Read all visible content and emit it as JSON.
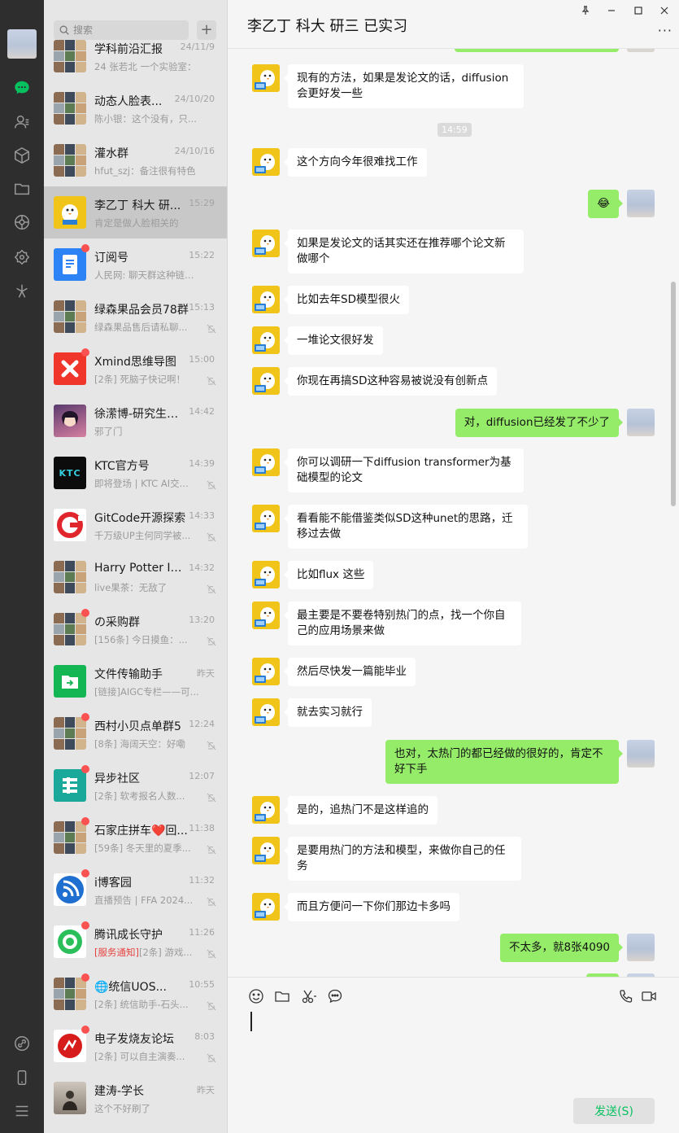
{
  "search": {
    "placeholder": "搜索"
  },
  "sidebar_icons": [
    "chat-icon",
    "contacts-icon",
    "cube-icon",
    "folder-icon",
    "moments-icon",
    "mini-program-icon",
    "channels-icon",
    "link-icon",
    "phone-icon",
    "menu-icon"
  ],
  "sessions": [
    {
      "name": "学科前沿汇报",
      "time": "24/11/9",
      "preview": "24 张若北 一个实验室："
    },
    {
      "name": "动态人脸表...",
      "time": "24/10/20",
      "preview": "陈小银：这个没有，只..."
    },
    {
      "name": "灌水群",
      "time": "24/10/16",
      "preview": "hfut_szj：备注很有特色"
    },
    {
      "name": "李乙丁 科大 研...",
      "time": "15:29",
      "preview": "肯定是做人脸相关的"
    },
    {
      "name": "订阅号",
      "time": "15:22",
      "preview": "人民网: 聊天群这种链接..."
    },
    {
      "name": "绿森果品会员78群",
      "time": "15:13",
      "preview": "绿森果品售后请私聊..."
    },
    {
      "name": "Xmind思维导图",
      "time": "15:00",
      "preview": "[2条] 死脑子快记啊！"
    },
    {
      "name": "徐潆博-研究生同...",
      "time": "14:42",
      "preview": "邪了门"
    },
    {
      "name": "KTC官方号",
      "time": "14:39",
      "preview": "即将登场 | KTC AI交..."
    },
    {
      "name": "GitCode开源探索",
      "time": "14:33",
      "preview": "千万级UP主何同学被..."
    },
    {
      "name": "Harry Potter IM...",
      "time": "14:32",
      "preview": "live果茶：无敌了"
    },
    {
      "name": "の采购群",
      "time": "13:20",
      "preview": "[156条] 今日摸鱼：..."
    },
    {
      "name": "文件传输助手",
      "time": "昨天",
      "preview": "[链接]AIGC专栏——可..."
    },
    {
      "name": "西村小贝点单群5",
      "time": "12:24",
      "preview": "[8条] 海阔天空：好嘞"
    },
    {
      "name": "异步社区",
      "time": "12:07",
      "preview": "[2条] 软考报名人数..."
    },
    {
      "name": "石家庄拼车❤️回...",
      "time": "11:38",
      "preview": "[59条] 冬天里的夏季..."
    },
    {
      "name": "i博客园",
      "time": "11:32",
      "preview": "直播预告 | FFA 2024..."
    },
    {
      "name": "腾讯成长守护",
      "time": "11:26",
      "preview_red": "[服务通知]",
      "preview": "[2条] 游戏..."
    },
    {
      "name": "🌐统信UOS...",
      "time": "10:55",
      "preview": "[2条] 统信助手-石头..."
    },
    {
      "name": "电子发烧友论坛",
      "time": "8:03",
      "preview": "[2条] 可以自主演奏..."
    },
    {
      "name": "建涛-学长",
      "time": "昨天",
      "preview": "这个不好刷了"
    }
  ],
  "chat": {
    "title": "李乙丁 科大 研三 已实习",
    "more_label": "···",
    "timestamp": "14:59",
    "messages": [
      {
        "side": "left",
        "text": "现有的方法，如果是发论文的话，diffusion会更好发一些"
      },
      {
        "side": "left",
        "text": "这个方向今年很难找工作"
      },
      {
        "side": "right",
        "text": "😂"
      },
      {
        "side": "left",
        "text": "如果是发论文的话其实还在推荐哪个论文新做哪个"
      },
      {
        "side": "left",
        "text": "比如去年SD模型很火"
      },
      {
        "side": "left",
        "text": "一堆论文很好发"
      },
      {
        "side": "left",
        "text": "你现在再搞SD这种容易被说没有创新点"
      },
      {
        "side": "right",
        "text": "对，diffusion已经发了不少了"
      },
      {
        "side": "left",
        "text": "你可以调研一下diffusion transformer为基础模型的论文"
      },
      {
        "side": "left",
        "text": "看看能不能借鉴类似SD这种unet的思路，迁移过去做"
      },
      {
        "side": "left",
        "text": "比如flux 这些"
      },
      {
        "side": "left",
        "text": "最主要是不要卷特别热门的点，找一个你自己的应用场景来做"
      },
      {
        "side": "left",
        "text": "然后尽快发一篇能毕业"
      },
      {
        "side": "left",
        "text": "就去实习就行"
      },
      {
        "side": "right",
        "text": "也对，太热门的都已经做的很好的，肯定不好下手"
      },
      {
        "side": "left",
        "text": "是的，追热门不是这样追的"
      },
      {
        "side": "left",
        "text": "是要用热门的方法和模型，来做你自己的任务"
      },
      {
        "side": "left",
        "text": "而且方便问一下你们那边卡多吗"
      },
      {
        "side": "right",
        "text": "不太多，就8张4090"
      }
    ]
  },
  "input": {
    "send_label": "发送(S)"
  },
  "colors": {
    "self_bubble": "#95ec69",
    "peer_bubble": "#ffffff",
    "accent": "#07c160",
    "badge": "#fa5151",
    "rail": "#2e2e2e"
  }
}
